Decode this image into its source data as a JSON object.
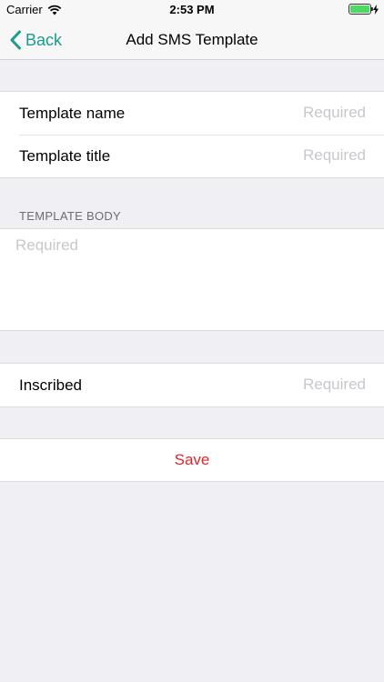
{
  "status_bar": {
    "carrier": "Carrier",
    "time": "2:53 PM",
    "battery_level_fraction": 1.0
  },
  "nav_bar": {
    "back_label": "Back",
    "title": "Add SMS Template",
    "accent_color": "#1a9b8c"
  },
  "form": {
    "fields": [
      {
        "label": "Template name",
        "value": "",
        "placeholder": "Required"
      },
      {
        "label": "Template title",
        "value": "",
        "placeholder": "Required"
      }
    ],
    "body_section_header": "TEMPLATE BODY",
    "body": {
      "value": "",
      "placeholder": "Required"
    },
    "inscribed": {
      "label": "Inscribed",
      "value": "",
      "placeholder": "Required"
    },
    "save_label": "Save",
    "save_color": "#e0242b"
  },
  "icons": {
    "back": "chevron-left-icon",
    "wifi": "wifi-icon",
    "battery": "battery-icon",
    "charging": "bolt-icon"
  }
}
